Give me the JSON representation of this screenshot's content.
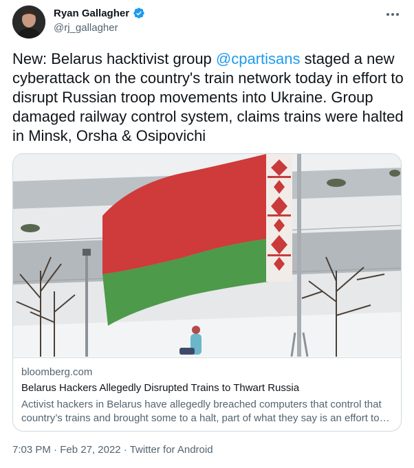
{
  "author": {
    "display_name": "Ryan Gallagher",
    "handle": "@rj_gallagher",
    "verified": true
  },
  "tweet": {
    "text_before": "New: Belarus hacktivist group ",
    "mention": "@cpartisans",
    "text_after": " staged a new cyberattack on the country's train network today in effort to disrupt Russian troop movements into Ukraine. Group damaged railway control system, claims trains were halted in Minsk, Orsha & Osipovichi"
  },
  "card": {
    "domain": "bloomberg.com",
    "title": "Belarus Hackers Allegedly Disrupted Trains to Thwart Russia",
    "description": "Activist hackers in Belarus have allegedly breached computers that control that country’s trains and brought some to a halt, part of what they say is an effort to hinder Russian troop movements."
  },
  "meta": {
    "time": "7:03 PM",
    "separator1": " · ",
    "date": "Feb 27, 2022",
    "separator2": " · ",
    "source": "Twitter for Android"
  },
  "colors": {
    "link": "#1d9bf0",
    "secondary_text": "#536471",
    "flag_red": "#cf3a3a",
    "flag_green": "#4d9a4a"
  },
  "icons": {
    "verified": "verified-badge-icon",
    "more": "more-options-icon"
  }
}
